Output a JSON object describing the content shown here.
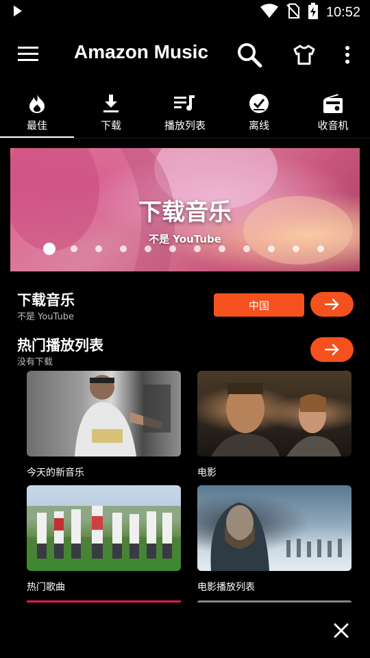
{
  "status_bar": {
    "time": "10:52"
  },
  "app_bar": {
    "title": "Amazon Music"
  },
  "tabs": [
    {
      "label": "最佳",
      "icon": "flame-icon",
      "active": true
    },
    {
      "label": "下载",
      "icon": "download-icon",
      "active": false
    },
    {
      "label": "播放列表",
      "icon": "playlist-icon",
      "active": false
    },
    {
      "label": "离线",
      "icon": "offline-check-icon",
      "active": false
    },
    {
      "label": "收音机",
      "icon": "radio-icon",
      "active": false
    }
  ],
  "banner": {
    "title": "下载音乐",
    "subtitle": "不是 YouTube",
    "dot_count": 12,
    "active_dot": 0
  },
  "section_download": {
    "title": "下载音乐",
    "subtitle": "不是 YouTube",
    "region_button": "中国"
  },
  "section_playlists": {
    "title": "热门播放列表",
    "subtitle": "没有下载",
    "cards": [
      {
        "label": "今天的新音乐"
      },
      {
        "label": "电影"
      },
      {
        "label": "热门歌曲"
      },
      {
        "label": "电影播放列表"
      }
    ]
  },
  "colors": {
    "accent": "#f4511e",
    "bottom_accent": "#e8194f",
    "background": "#000000"
  }
}
